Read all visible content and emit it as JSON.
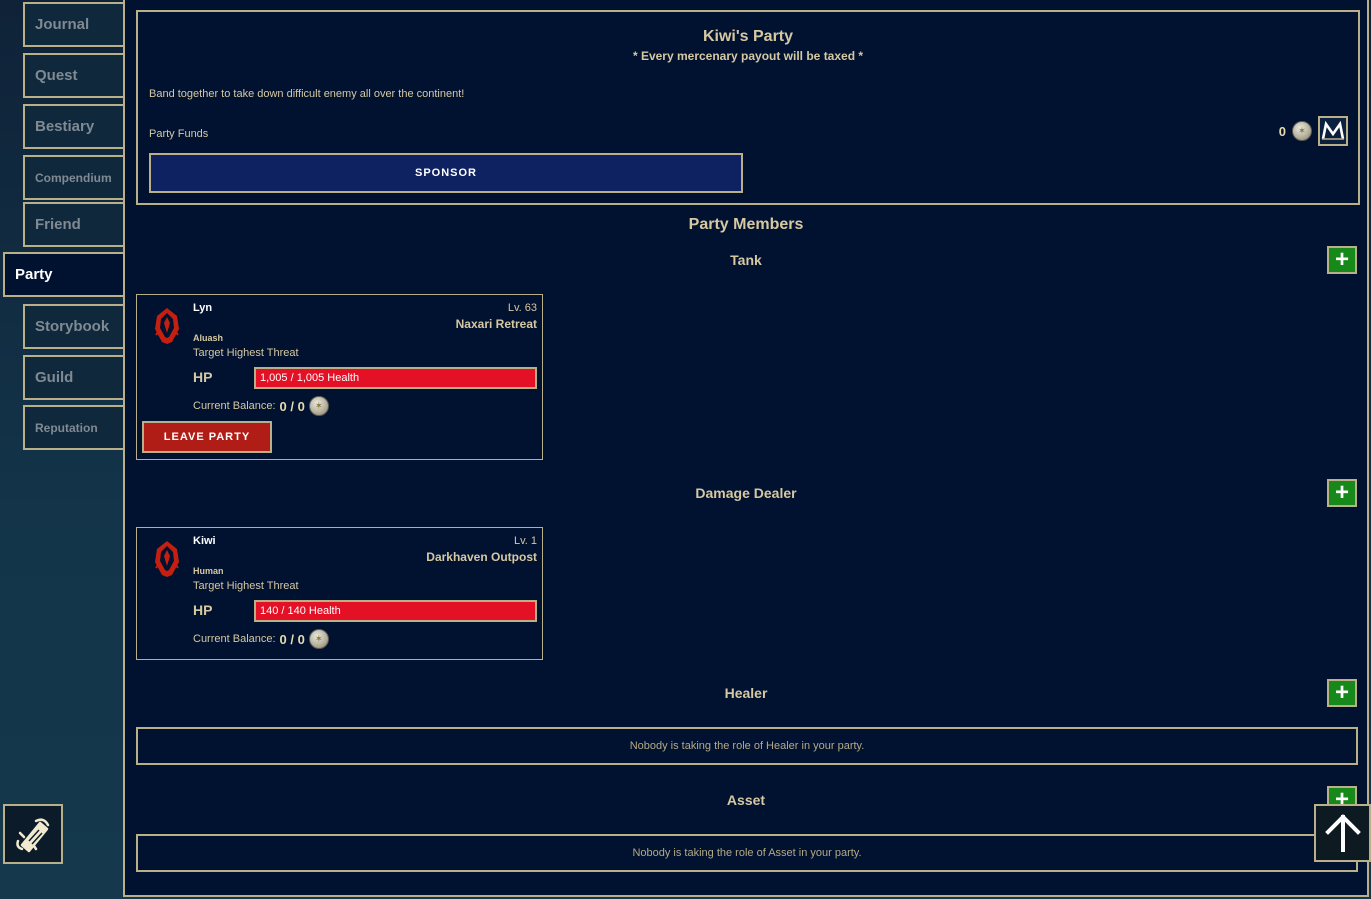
{
  "sidebar": {
    "tabs": [
      {
        "label": "Journal"
      },
      {
        "label": "Quest"
      },
      {
        "label": "Bestiary"
      },
      {
        "label": "Compendium"
      },
      {
        "label": "Friend"
      },
      {
        "label": "Party"
      },
      {
        "label": "Storybook"
      },
      {
        "label": "Guild"
      },
      {
        "label": "Reputation"
      }
    ],
    "active_tab": "Party"
  },
  "party": {
    "title": "Kiwi's Party",
    "subtitle": "* Every mercenary payout will be taxed *",
    "description": "Band together to take down difficult enemy all over the continent!",
    "funds_label": "Party Funds",
    "funds_value": "0",
    "sponsor_label": "SPONSOR"
  },
  "members_section": {
    "title": "Party Members",
    "roles": {
      "tank": "Tank",
      "damage": "Damage Dealer",
      "healer": "Healer",
      "asset": "Asset"
    }
  },
  "members": [
    {
      "name": "Lyn",
      "level": "Lv. 63",
      "location": "Naxari Retreat",
      "race": "Aluash",
      "target": "Target Highest Threat",
      "hp_label": "HP",
      "hp_text": "1,005 / 1,005 Health",
      "balance_label": "Current Balance:",
      "balance_value": "0 / 0",
      "leave_label": "LEAVE PARTY"
    },
    {
      "name": "Kiwi",
      "level": "Lv. 1",
      "location": "Darkhaven Outpost",
      "race": "Human",
      "target": "Target Highest Threat",
      "hp_label": "HP",
      "hp_text": "140 / 140 Health",
      "balance_label": "Current Balance:",
      "balance_value": "0 / 0"
    }
  ],
  "empty_messages": {
    "healer": "Nobody is taking the role of Healer in your party.",
    "asset": "Nobody is taking the role of Asset in your party."
  },
  "colors": {
    "background": "#011130",
    "border": "#b9b08a",
    "text": "#d6c9a2",
    "add_button": "#17891a",
    "leave_button": "#b01d16",
    "sponsor_button": "#0e2262",
    "hp_bar": "#e41025"
  },
  "icons": [
    "scroll-icon",
    "coin-icon",
    "market-icon",
    "plus-icon",
    "faction-icon",
    "arrow-up-icon"
  ]
}
